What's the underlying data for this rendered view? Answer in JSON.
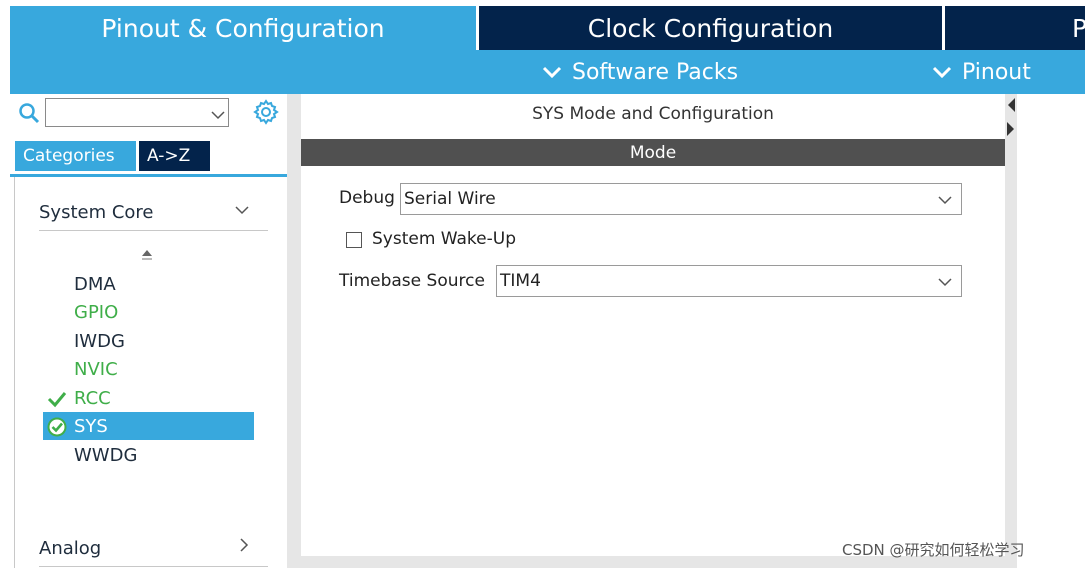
{
  "tabs": [
    {
      "label": "Pinout & Configuration",
      "active": true
    },
    {
      "label": "Clock Configuration",
      "active": false
    },
    {
      "label": "P",
      "active": false
    }
  ],
  "subbar": {
    "software_packs": "Software Packs",
    "pinout": "Pinout"
  },
  "sidebar": {
    "search": {
      "value": "",
      "placeholder": ""
    },
    "tabs": {
      "categories": "Categories",
      "az": "A->Z"
    },
    "groups": [
      {
        "label": "System Core",
        "expanded": true
      },
      {
        "label": "Analog",
        "expanded": false
      }
    ],
    "peripherals": [
      {
        "label": "DMA",
        "status": "none"
      },
      {
        "label": "GPIO",
        "status": "configured"
      },
      {
        "label": "IWDG",
        "status": "none"
      },
      {
        "label": "NVIC",
        "status": "configured"
      },
      {
        "label": "RCC",
        "status": "ok"
      },
      {
        "label": "SYS",
        "status": "selected-ok"
      },
      {
        "label": "WWDG",
        "status": "none"
      }
    ]
  },
  "main": {
    "title": "SYS Mode and Configuration",
    "section": "Mode",
    "debug": {
      "label": "Debug",
      "value": "Serial Wire"
    },
    "wakeup": {
      "label": "System Wake-Up",
      "checked": false
    },
    "timebase": {
      "label": "Timebase Source",
      "value": "TIM4"
    }
  },
  "watermark": "CSDN @研究如何轻松学习",
  "colors": {
    "accent": "#38a8dd",
    "navy": "#03234b",
    "configured_green": "#3fae49",
    "mode_bar": "#505050"
  }
}
